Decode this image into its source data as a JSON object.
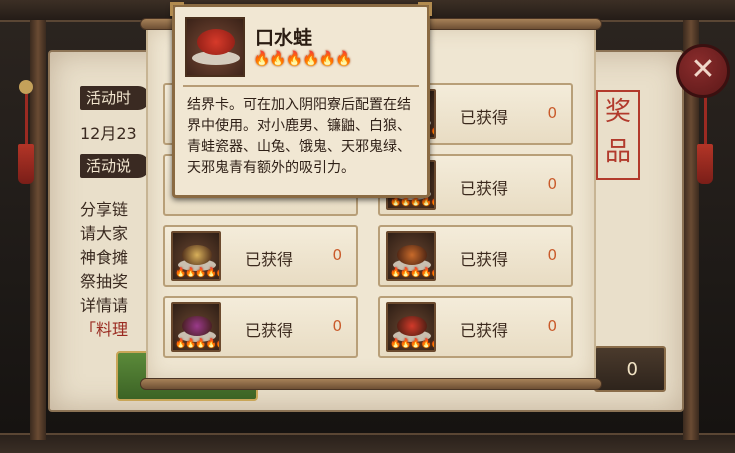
{
  "background": {
    "headings": [
      "活动时",
      "活动说"
    ],
    "date_fragment": "12月23",
    "paragraph_fragments": [
      "分享链",
      "请大家",
      "神食摊",
      "祭抽奖",
      "详情请"
    ],
    "red_fragment": "「料理",
    "stamp_text": "奖品",
    "counter_value": "0"
  },
  "close_button": {
    "label": "✕"
  },
  "tooltip": {
    "title": "口水蛙",
    "flames": "🔥🔥🔥🔥🔥🔥",
    "description": "结界卡。可在加入阴阳寮后配置在结界中使用。对小鹿男、镰鼬、白狼、青蛙瓷器、山兔、饿鬼、天邪鬼绿、天邪鬼青有额外的吸引力。"
  },
  "grid": {
    "status_label": "已获得",
    "items": [
      {
        "count": "0",
        "food_color": "#c9a24a"
      },
      {
        "count": "0",
        "food_color": "#c84a3a"
      },
      {
        "count": "0",
        "food_color": "#d8b05a"
      },
      {
        "count": "0",
        "food_color": "#c86a2a"
      },
      {
        "count": "0",
        "food_color": "#9a3a8a"
      },
      {
        "count": "0",
        "food_color": "#d23a2a"
      }
    ]
  },
  "colors": {
    "accent_red": "#c95a2a",
    "flame": "#f39a1d"
  }
}
